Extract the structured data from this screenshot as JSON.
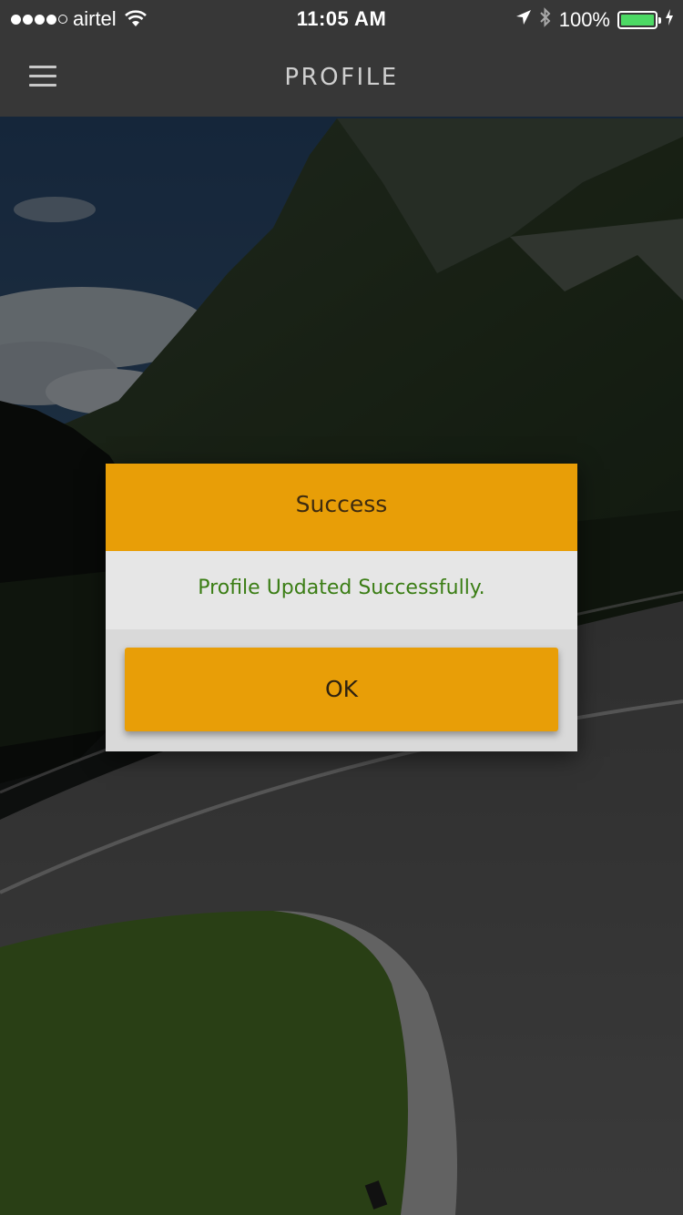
{
  "status_bar": {
    "signal_dots_filled": 4,
    "signal_dots_total": 5,
    "carrier": "airtel",
    "time": "11:05 AM",
    "battery_percent_label": "100%",
    "battery_level": 1.0,
    "icons": [
      "wifi-icon",
      "location-arrow-icon",
      "bluetooth-icon",
      "battery-icon",
      "charging-bolt-icon"
    ]
  },
  "nav": {
    "title": "PROFILE",
    "menu_icon": "hamburger-menu-icon"
  },
  "dialog": {
    "title": "Success",
    "message": "Profile Updated Successfully.",
    "ok_label": "OK"
  },
  "colors": {
    "bar_background": "#373737",
    "accent_orange": "#e89e07",
    "message_green": "#3a7d14",
    "battery_green": "#4cd964"
  }
}
